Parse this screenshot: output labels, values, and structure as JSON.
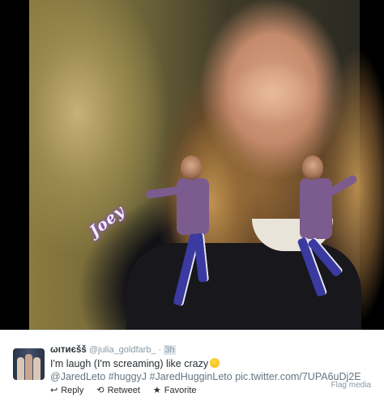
{
  "photo": {
    "overlay_text": "Joey"
  },
  "tweet": {
    "display_name": "ωιтиєšš",
    "handle": "@julia_goldfarb_",
    "separator": "·",
    "time": "3h",
    "text_line1": "I'm laugh (I'm screaming) like crazy",
    "mention": "@JaredLeto",
    "hashtag1": "#huggyJ",
    "hashtag2": "#JaredHugginLeto",
    "link": "pic.twitter.com/7UPA6uDj2E",
    "flag_media_label": "Flag media"
  },
  "actions": [
    {
      "label": "Reply",
      "icon": "reply-icon",
      "glyph": "↩"
    },
    {
      "label": "Retweet",
      "icon": "retweet-icon",
      "glyph": "⟲"
    },
    {
      "label": "Favorite",
      "icon": "star-icon",
      "glyph": "★"
    }
  ],
  "colors": {
    "link_gray": "#66757f",
    "muted": "#8899a6",
    "text": "#292f33"
  }
}
